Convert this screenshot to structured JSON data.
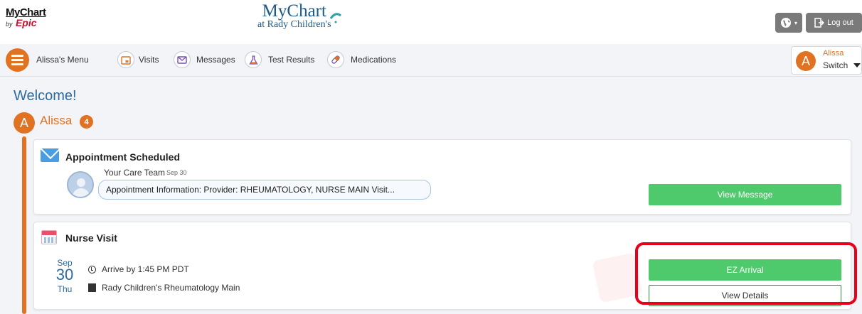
{
  "header": {
    "mychart_small": "MyChart",
    "by": "by",
    "epic": "Epic",
    "logo_title": "MyChart",
    "logo_subtitle": "at Rady Children's",
    "logout_label": "Log out"
  },
  "nav": {
    "menu_label": "Alissa's Menu",
    "items": [
      {
        "label": "Visits",
        "icon": "calendar-icon"
      },
      {
        "label": "Messages",
        "icon": "envelope-icon"
      },
      {
        "label": "Test Results",
        "icon": "flask-icon"
      },
      {
        "label": "Medications",
        "icon": "pill-icon"
      }
    ],
    "switch": {
      "initial": "A",
      "name": "Alissa",
      "label": "Switch"
    }
  },
  "main": {
    "welcome": "Welcome!",
    "user": {
      "initial": "A",
      "name": "Alissa",
      "badge": "4"
    }
  },
  "cards": {
    "message": {
      "title": "Appointment Scheduled",
      "sender": "Your Care Team",
      "date": "Sep 30",
      "preview": "Appointment Information: Provider: RHEUMATOLOGY, NURSE MAIN Visit...",
      "button": "View Message"
    },
    "visit": {
      "title": "Nurse Visit",
      "month": "Sep",
      "day": "30",
      "dow": "Thu",
      "arrive": "Arrive by 1:45 PM PDT",
      "location": "Rady Children's Rheumatology Main",
      "ez_button": "EZ Arrival",
      "details_button": "View Details"
    }
  },
  "colors": {
    "accent": "#e07222",
    "link_blue": "#2c6aa0",
    "button_green": "#4ec96b",
    "highlight_red": "#e8001a"
  }
}
